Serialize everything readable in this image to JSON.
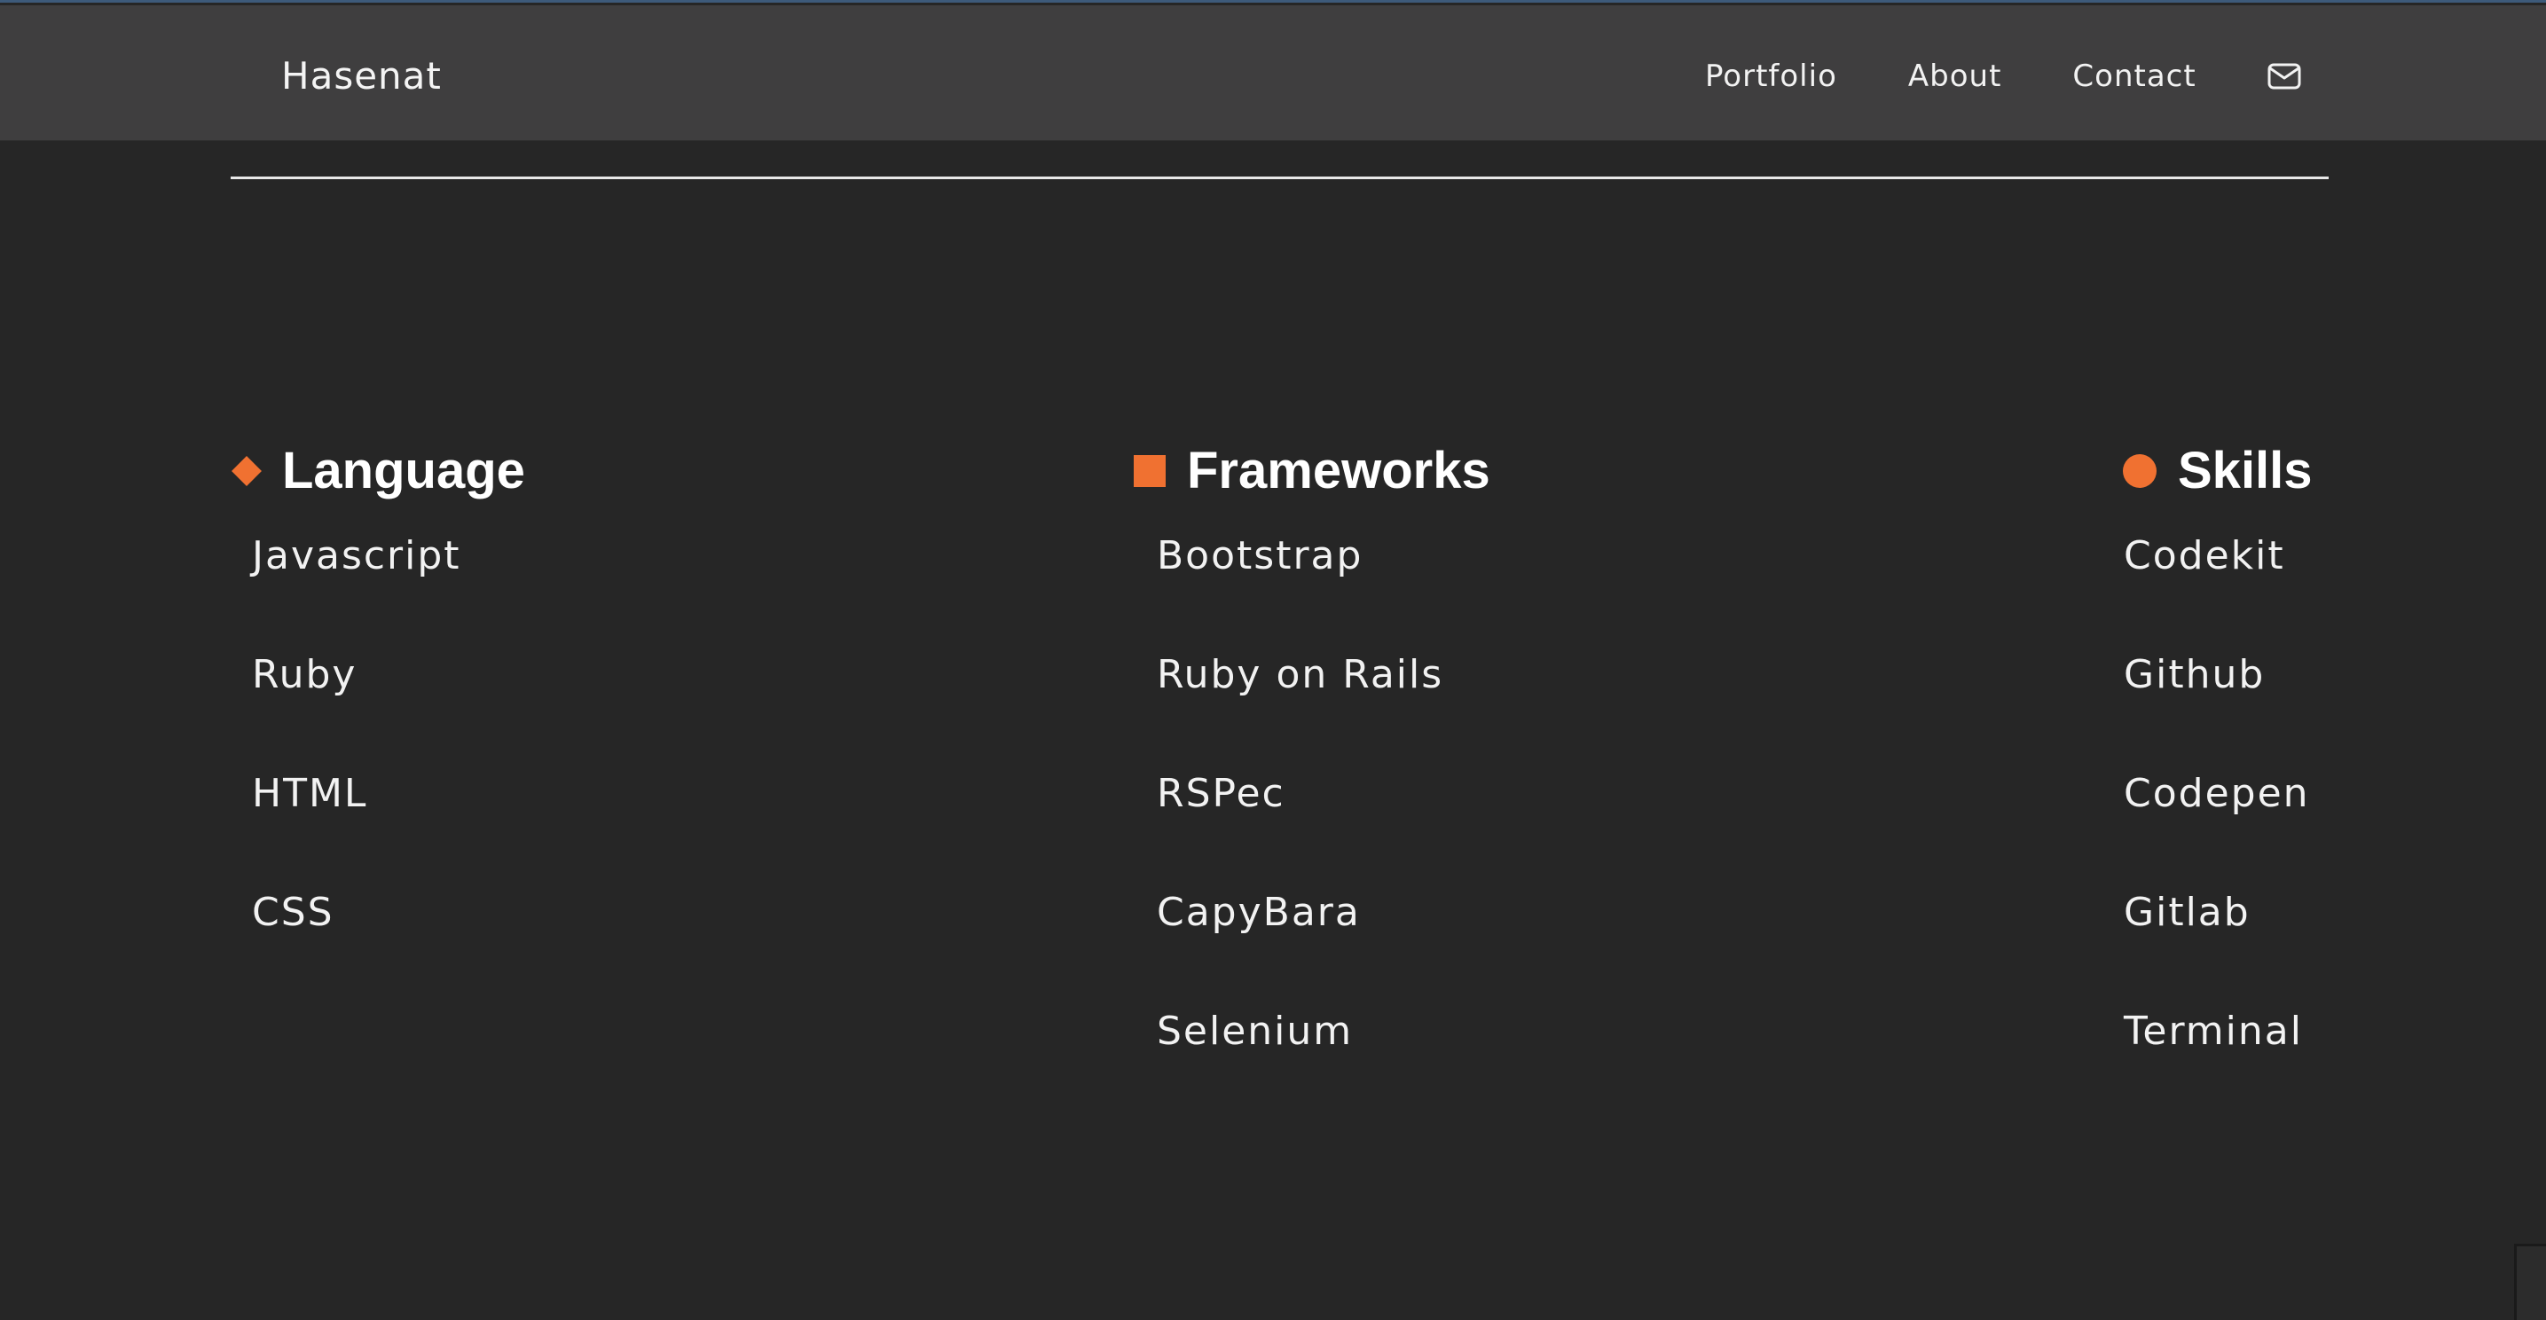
{
  "navbar": {
    "brand": "Hasenat",
    "links": {
      "portfolio": "Portfolio",
      "about": "About",
      "contact": "Contact"
    },
    "mail_icon": "envelope-icon"
  },
  "sections": {
    "language": {
      "title": "Language",
      "marker": "diamond",
      "items": [
        "Javascript",
        "Ruby",
        "HTML",
        "CSS"
      ]
    },
    "frameworks": {
      "title": "Frameworks",
      "marker": "square",
      "items": [
        "Bootstrap",
        "Ruby on Rails",
        "RSPec",
        "CapyBara",
        "Selenium"
      ]
    },
    "skills": {
      "title": "Skills",
      "marker": "circle",
      "items": [
        "Codekit",
        "Github",
        "Codepen",
        "Gitlab",
        "Terminal"
      ]
    }
  },
  "colors": {
    "accent": "#f07131",
    "background": "#262626",
    "navbar": "#3f3e3f",
    "text": "#f2f2f2"
  }
}
